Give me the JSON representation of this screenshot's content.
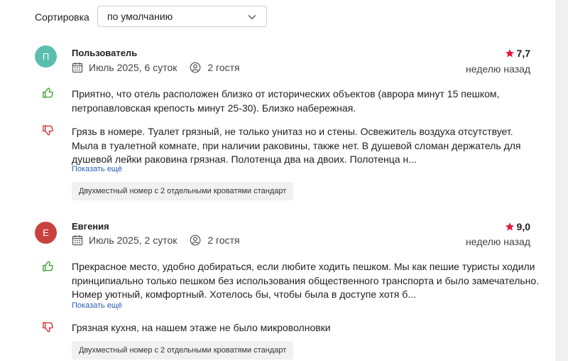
{
  "sort": {
    "label": "Сортировка",
    "selected": "по умолчанию"
  },
  "reviews": [
    {
      "initial": "П",
      "avatar_color": "#5bbfae",
      "author": "Пользователь",
      "date": "Июль 2025, 6 суток",
      "guests": "2 гостя",
      "rating": "7,7",
      "when": "неделю назад",
      "pros": "Приятно, что отель расположен близко от исторических объектов (аврора минут 15 пешком, петропавловская крепость минут 25-30). Близко набережная.",
      "cons": "Грязь в номере. Туалет грязный, не только унитаз но и стены. Освежитель воздуха отсутствует. Мыла в туалетной комнате, при наличии раковины, также нет. В душевой сломан держатель для душевой лейки раковина грязная. Полотенца два на двоих. Полотенца н...",
      "more": "Показать ещё",
      "room": "Двухместный номер с 2 отдельными кроватями стандарт"
    },
    {
      "initial": "Е",
      "avatar_color": "#c9413f",
      "author": "Евгения",
      "date": "Июль 2025, 2 суток",
      "guests": "2 гостя",
      "rating": "9,0",
      "when": "неделю назад",
      "pros": "Прекрасное место, удобно добираться, если любите ходить пешком. Мы как пешие туристы ходили принципиально только пешком без использования общественного транспорта и было замечательно. Номер уютный, комфортный. Хотелось бы, чтобы была в доступе хотя б...",
      "more": "Показать ещё",
      "cons": "Грязная кухня, на нашем этаже не было микроволновки",
      "room": "Двухместный номер с 2 отдельными кроватями стандарт"
    }
  ],
  "colors": {
    "star": "#e8173c",
    "like": "#3a9b2e",
    "dislike": "#d12a2a",
    "link": "#2a5db0"
  },
  "icons": {
    "calendar": "calendar-icon",
    "guests": "person-icon",
    "star": "star-icon",
    "like": "thumbs-up-icon",
    "dislike": "thumbs-down-icon",
    "dropdown": "chevron-down-icon"
  }
}
